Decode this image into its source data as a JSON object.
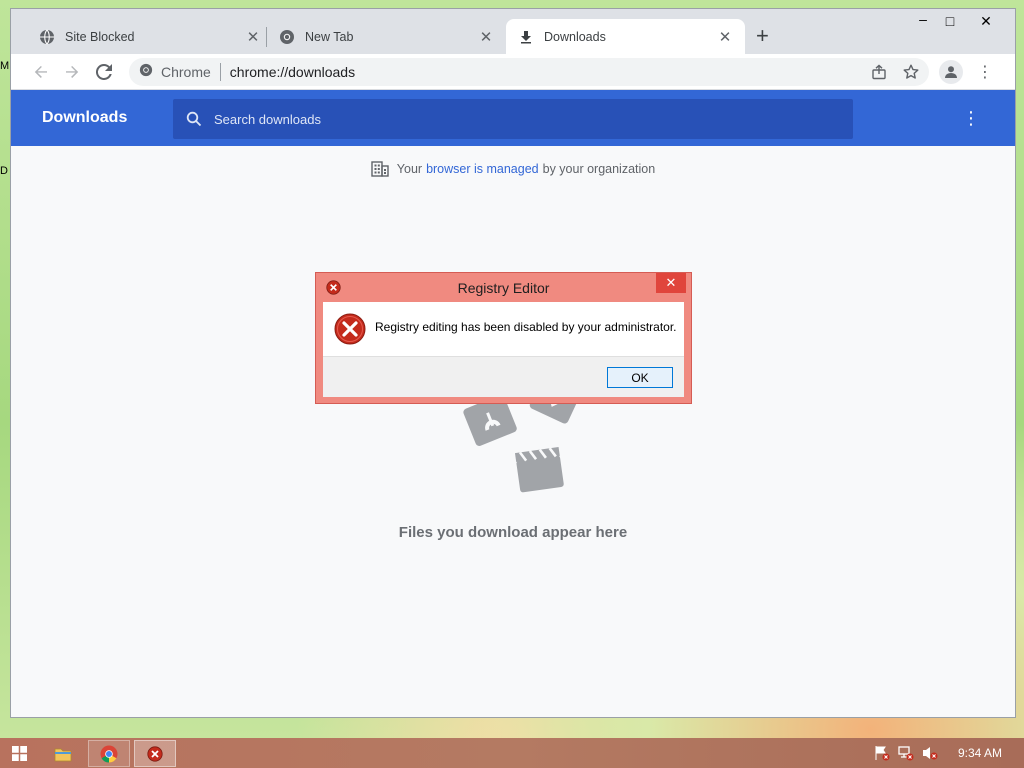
{
  "desktop": {
    "edge_fragments": [
      "M",
      "D"
    ]
  },
  "browser": {
    "tabs": [
      {
        "title": "Site Blocked",
        "icon": "globe-icon",
        "active": false
      },
      {
        "title": "New Tab",
        "icon": "chrome-icon",
        "active": false
      },
      {
        "title": "Downloads",
        "icon": "download-icon",
        "active": true
      }
    ],
    "new_tab_label": "+",
    "window_controls": {
      "minimize": "–",
      "maximize": "□",
      "close": "✕"
    },
    "omnibox": {
      "site_label": "Chrome",
      "url": "chrome://downloads"
    }
  },
  "downloads_page": {
    "title": "Downloads",
    "search_placeholder": "Search downloads",
    "managed_notice": {
      "prefix": "Your",
      "link": "browser is managed",
      "suffix": "by your organization"
    },
    "empty_message": "Files you download appear here"
  },
  "dialog": {
    "title": "Registry Editor",
    "message": "Registry editing has been disabled by your administrator.",
    "ok_label": "OK",
    "close_label": "✕"
  },
  "taskbar": {
    "items": [
      {
        "name": "start-button",
        "icon": "windows-logo-icon"
      },
      {
        "name": "file-explorer",
        "icon": "folder-icon"
      },
      {
        "name": "chrome",
        "icon": "chrome-icon"
      },
      {
        "name": "registry-error",
        "icon": "error-icon",
        "active": true
      }
    ],
    "tray_icons": [
      "action-center-flag-icon",
      "network-icon",
      "volume-muted-icon"
    ],
    "time": "9:34 AM"
  },
  "colors": {
    "header_blue": "#3367d6",
    "search_blue": "#2851b7",
    "dialog_frame": "#f08a80",
    "error_red": "#c42b1c"
  }
}
